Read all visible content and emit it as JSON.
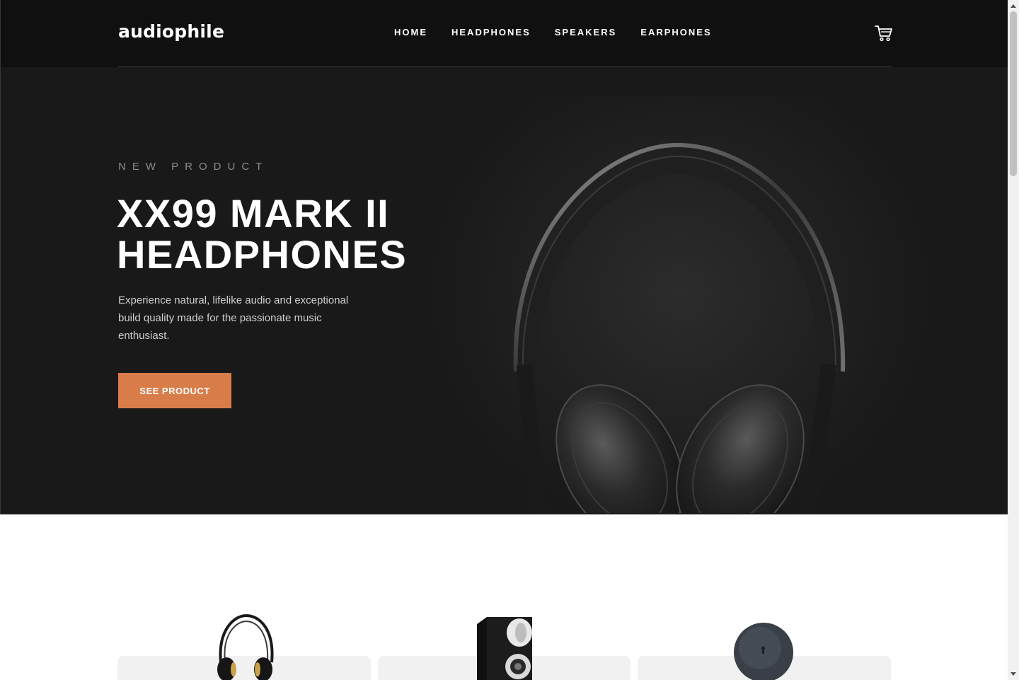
{
  "header": {
    "logo": "audiophile",
    "nav": [
      "HOME",
      "HEADPHONES",
      "SPEAKERS",
      "EARPHONES"
    ],
    "cart_icon": "cart-icon"
  },
  "hero": {
    "eyebrow": "NEW PRODUCT",
    "title_line1": "XX99 MARK II",
    "title_line2": "HEADPHONES",
    "description": "Experience natural, lifelike audio and exceptional build quality made for the passionate music enthusiast.",
    "cta_label": "SEE PRODUCT"
  },
  "categories": [
    {
      "icon": "headphones-image"
    },
    {
      "icon": "speaker-image"
    },
    {
      "icon": "earphones-image"
    }
  ],
  "colors": {
    "header_bg": "#101010",
    "hero_bg": "#191919",
    "accent": "#d87d4a",
    "card_bg": "#f1f1f1"
  }
}
